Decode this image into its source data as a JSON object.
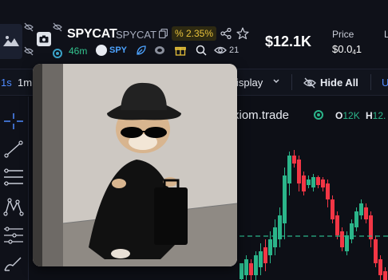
{
  "header": {
    "token_name": "SPYCAT",
    "token_ticker": "SPYCAT",
    "change_pct": "% 2.35%",
    "age": "46m",
    "tag_label": "SPY",
    "views": "21",
    "market_cap": "$12.1K",
    "price_label": "Price",
    "price_main": "$0.0",
    "price_sub": "4",
    "price_tail": "1",
    "cut_label": "L"
  },
  "toolbar": {
    "tf_1s": "1s",
    "tf_1m": "1m",
    "display_label": "isplay",
    "hide_all_label": "Hide All",
    "cut_label": "U"
  },
  "chart": {
    "source_label": "xiom.trade",
    "ohlc_o_label": "O",
    "ohlc_o_value": "12K",
    "ohlc_h_label": "H",
    "ohlc_h_value": "12."
  },
  "colors": {
    "up": "#2bb58a",
    "down": "#f23645",
    "accent": "#4f8bff",
    "badge_text": "#e8c23b"
  },
  "icons": [
    "token-image-icon",
    "camera-icon",
    "copy-icon",
    "share-icon",
    "star-icon",
    "tag-icon",
    "leaf-icon",
    "pump-icon",
    "gift-icon",
    "search-icon",
    "eye-icon",
    "crosshair-icon",
    "trendline-icon",
    "fib-icon",
    "pattern-icon",
    "measure-icon",
    "brush-icon"
  ]
}
